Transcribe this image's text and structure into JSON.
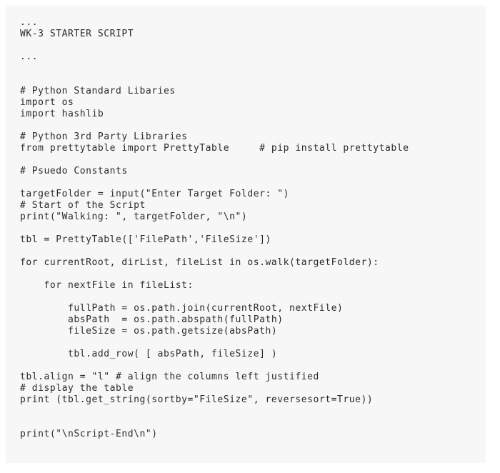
{
  "panel": {
    "background_color": "#f7f7f7",
    "page_background_color": "#ffffff",
    "text_color": "#2b2b2b"
  },
  "code": {
    "language": "python",
    "lines": [
      "...",
      "WK-3 STARTER SCRIPT",
      "",
      "...",
      "",
      "",
      "# Python Standard Libaries",
      "import os",
      "import hashlib",
      "",
      "# Python 3rd Party Libraries",
      "from prettytable import PrettyTable     # pip install prettytable",
      "",
      "# Psuedo Constants",
      "",
      "targetFolder = input(\"Enter Target Folder: \")",
      "# Start of the Script",
      "print(\"Walking: \", targetFolder, \"\\n\")",
      "",
      "tbl = PrettyTable(['FilePath','FileSize'])",
      "",
      "for currentRoot, dirList, fileList in os.walk(targetFolder):",
      "",
      "    for nextFile in fileList:",
      "",
      "        fullPath = os.path.join(currentRoot, nextFile)",
      "        absPath  = os.path.abspath(fullPath)",
      "        fileSize = os.path.getsize(absPath)",
      "",
      "        tbl.add_row( [ absPath, fileSize] )",
      "",
      "tbl.align = \"l\" # align the columns left justified",
      "# display the table",
      "print (tbl.get_string(sortby=\"FileSize\", reversesort=True))",
      "",
      "",
      "print(\"\\nScript-End\\n\")"
    ]
  }
}
